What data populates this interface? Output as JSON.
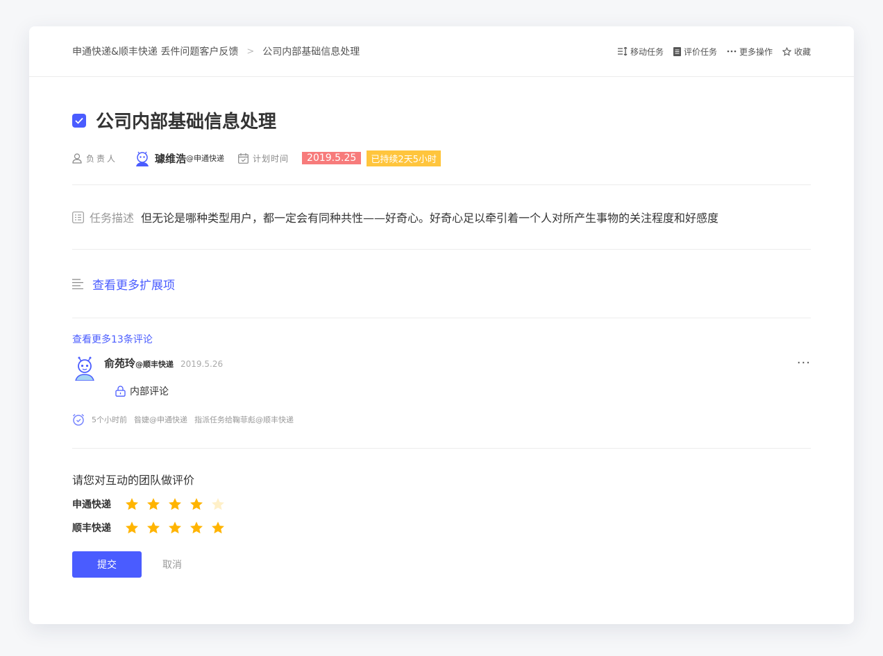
{
  "breadcrumb": {
    "project": "申通快递&顺丰快递 丢件问题客户反馈",
    "separator": ">",
    "current": "公司内部基础信息处理"
  },
  "actions": [
    {
      "label": "移动任务",
      "icon": "move-icon"
    },
    {
      "label": "评价任务",
      "icon": "document-icon"
    },
    {
      "label": "更多操作",
      "icon": "more-dots-icon"
    },
    {
      "label": "收藏",
      "icon": "star-outline-icon"
    }
  ],
  "task": {
    "title": "公司内部基础信息处理",
    "checked": true,
    "owner_label": "负责人",
    "owner_name": "璩维浩",
    "owner_org": "@申通快递",
    "plan_label": "计划时间",
    "plan_date": "2019.5.25",
    "duration": "已持续2天5小时",
    "desc_label": "任务描述",
    "desc_text": "但无论是哪种类型用户，都一定会有同种共性——好奇心。好奇心足以牵引着一个人对所产生事物的关注程度和好感度"
  },
  "extensions_link": "查看更多扩展项",
  "comments": {
    "more_link": "查看更多13条评论",
    "item": {
      "name": "俞苑玲",
      "org": "@顺丰快递",
      "date": "2019.5.26",
      "tag": "内部评论",
      "menu": "···"
    },
    "activity": {
      "time": "5个小时前",
      "actor": "昝婕@申通快递",
      "action": "指派任务给鞠菲彪@顺丰快递"
    }
  },
  "rating": {
    "title": "请您对互动的团队做评价",
    "rows": [
      {
        "label": "申通快递",
        "stars": 4,
        "max": 5
      },
      {
        "label": "顺丰快递",
        "stars": 5,
        "max": 5
      }
    ],
    "submit_label": "提交",
    "cancel_label": "取消"
  },
  "colors": {
    "accent": "#4a5cff",
    "date_tag": "#f77b7b",
    "duration_tag": "#ffc53d",
    "star_on": "#ffb400",
    "star_off": "#fff0c8"
  }
}
